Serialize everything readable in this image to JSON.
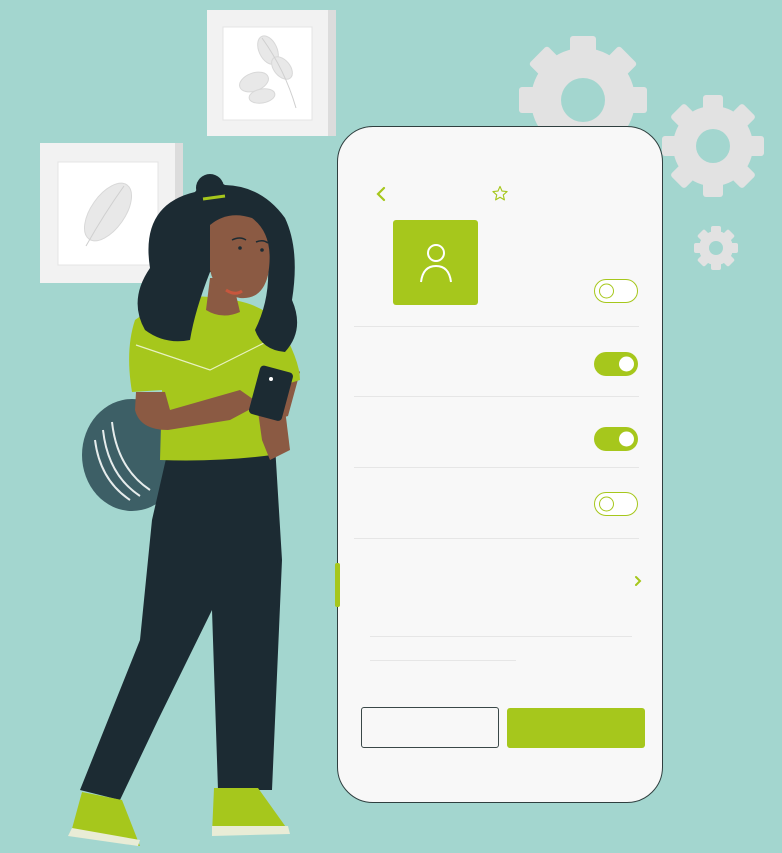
{
  "colors": {
    "background": "#a3d6cf",
    "accent": "#a6c71c",
    "phone_screen": "#f8f8f8",
    "dark": "#1c2b33",
    "gear": "#e2e2e2"
  },
  "icons": {
    "back": "chevron-left-icon",
    "favorite": "star-icon",
    "profile": "user-icon",
    "next": "chevron-right-icon"
  },
  "settings": {
    "toggles": [
      {
        "state": "off"
      },
      {
        "state": "on"
      },
      {
        "state": "on"
      },
      {
        "state": "off"
      }
    ]
  }
}
